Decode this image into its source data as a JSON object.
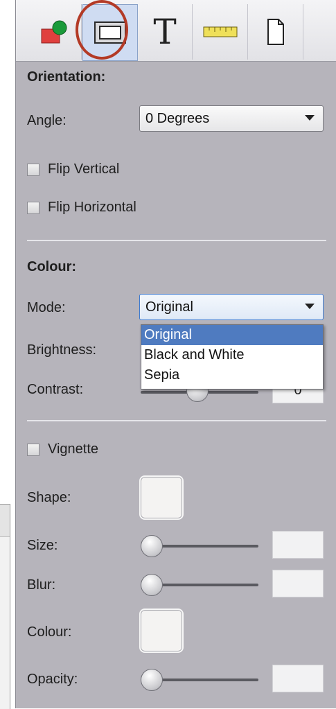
{
  "toolbar": {
    "tools": [
      {
        "icon": "shapes-icon"
      },
      {
        "icon": "frame-icon",
        "active": true
      },
      {
        "icon": "text-icon",
        "glyph": "T"
      },
      {
        "icon": "ruler-icon"
      },
      {
        "icon": "page-icon"
      }
    ]
  },
  "orientation": {
    "heading": "Orientation:",
    "angle_label": "Angle:",
    "angle_value": "0 Degrees",
    "flip_vertical": "Flip Vertical",
    "flip_horizontal": "Flip Horizontal"
  },
  "colour": {
    "heading": "Colour:",
    "mode_label": "Mode:",
    "mode_value": "Original",
    "mode_options": [
      "Original",
      "Black and White",
      "Sepia"
    ],
    "brightness_label": "Brightness:",
    "contrast_label": "Contrast:",
    "contrast_value": "0"
  },
  "vignette": {
    "label": "Vignette",
    "shape_label": "Shape:",
    "size_label": "Size:",
    "blur_label": "Blur:",
    "colour_label": "Colour:",
    "opacity_label": "Opacity:"
  },
  "colors": {
    "panel_bg": "#b6b4bb",
    "selection": "#4f7bc0",
    "annotation_circle": "#b33a26"
  }
}
